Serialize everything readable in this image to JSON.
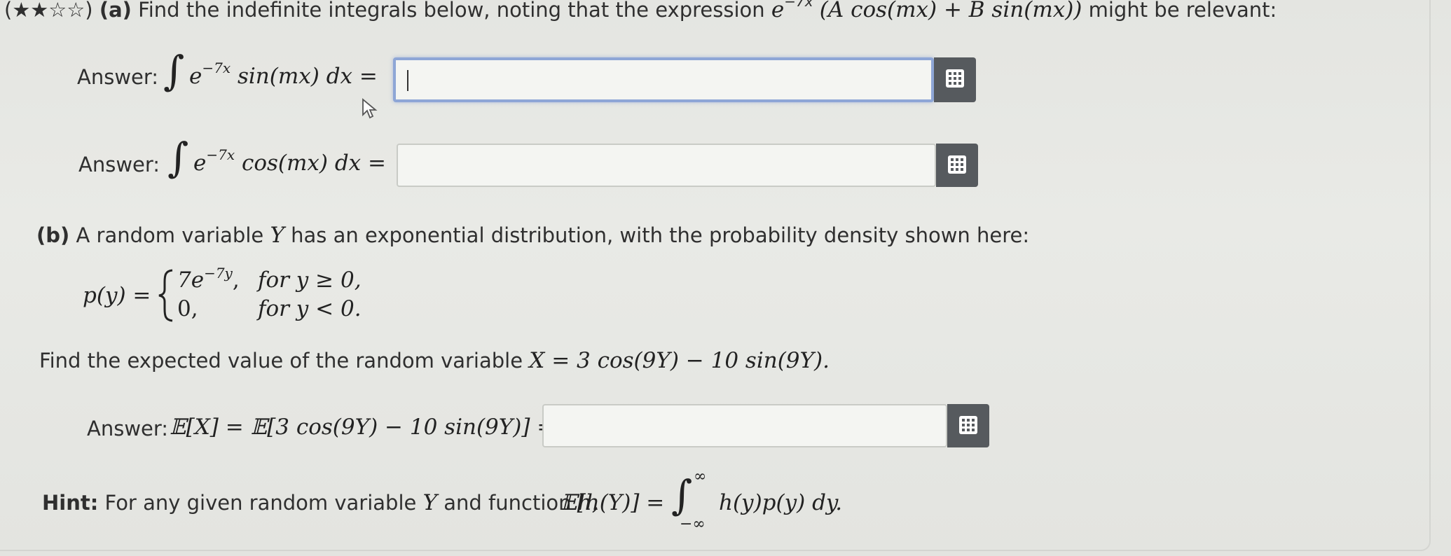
{
  "part_a": {
    "stars": "(★★☆☆)",
    "label": "(a)",
    "intro": "Find the indefinite integrals below, noting that the expression",
    "expr_base": "e",
    "expr_exp": "−7x",
    "expr_body": "(A cos(mx) + B sin(mx))",
    "intro_tail": "might be relevant:",
    "q1": {
      "prefix": "Answer:",
      "base": "e",
      "exp": "−7x",
      "body": "sin(mx) dx ="
    },
    "q2": {
      "prefix": "Answer:",
      "base": "e",
      "exp": "−7x",
      "body": "cos(mx) dx ="
    }
  },
  "part_b": {
    "label": "(b)",
    "intro_1": "A random variable",
    "var": "Y",
    "intro_2": "has an exponential distribution, with the probability density shown here:",
    "pdf_lhs": "p(y) =",
    "case1_base": "7e",
    "case1_exp": "−7y",
    "case1_comma": ",",
    "case1_cond": "for y ≥ 0,",
    "case2_val": "0,",
    "case2_cond": "for y < 0.",
    "find_text": "Find the expected value of the random variable",
    "find_math": "X = 3 cos(9Y) − 10 sin(9Y).",
    "q3": {
      "prefix": "Answer:",
      "math": "𝔼[X] = 𝔼[3 cos(9Y) − 10 sin(9Y)] ="
    },
    "hint_label": "Hint:",
    "hint_text_1": "For any given random variable",
    "hint_var": "Y",
    "hint_text_2": "and function",
    "hint_fn": "h,",
    "hint_lhs": "𝔼[h(Y)] =",
    "hint_upper": "∞",
    "hint_lower": "−∞",
    "hint_rhs": "h(y)p(y) dy."
  },
  "icons": {
    "keypad": "keypad-grid-icon",
    "cursor": "mouse-pointer-icon"
  },
  "colors": {
    "focus_border": "#8ea6d6",
    "keypad_bg": "#565a5e",
    "input_bg": "#f4f5f2"
  }
}
